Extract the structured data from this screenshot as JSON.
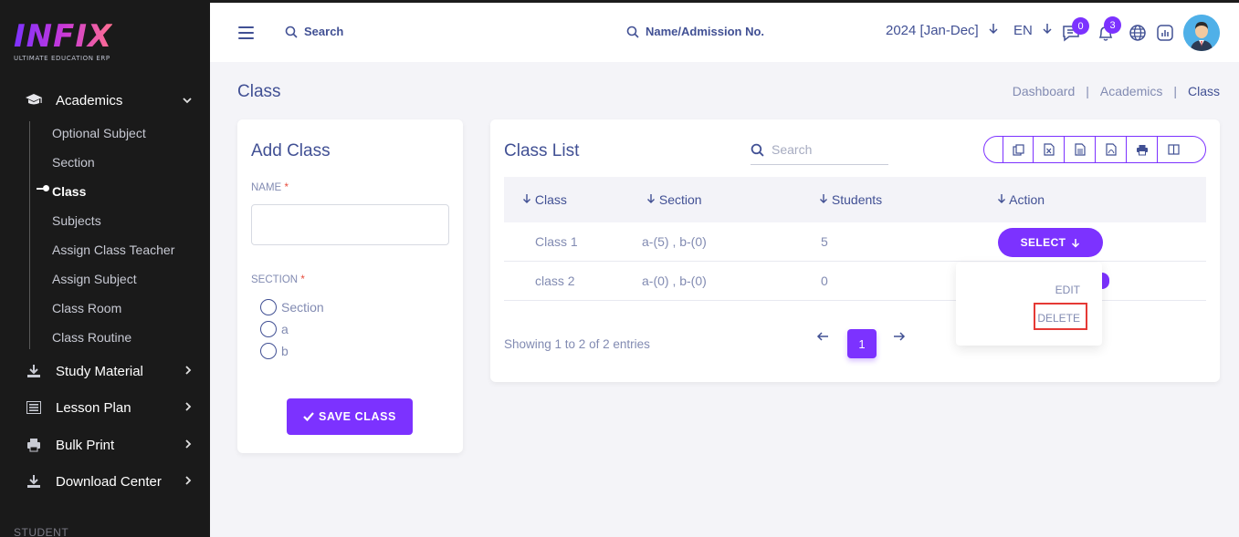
{
  "brand": {
    "name": "INFIX",
    "tagline": "ULTIMATE EDUCATION ERP"
  },
  "sidebar": {
    "academics": {
      "label": "Academics"
    },
    "academics_items": [
      {
        "label": "Optional Subject"
      },
      {
        "label": "Section"
      },
      {
        "label": "Class"
      },
      {
        "label": "Subjects"
      },
      {
        "label": "Assign Class Teacher"
      },
      {
        "label": "Assign Subject"
      },
      {
        "label": "Class Room"
      },
      {
        "label": "Class Routine"
      }
    ],
    "menu": [
      {
        "label": "Study Material"
      },
      {
        "label": "Lesson Plan"
      },
      {
        "label": "Bulk Print"
      },
      {
        "label": "Download Center"
      }
    ],
    "section_label": "STUDENT"
  },
  "header": {
    "search_label": "Search",
    "admission_search_label": "Name/Admission No.",
    "academic_year": "2024 [Jan-Dec]",
    "language": "EN",
    "messages_count": "0",
    "notifications_count": "3"
  },
  "page": {
    "title": "Class",
    "breadcrumb": [
      "Dashboard",
      "Academics",
      "Class"
    ]
  },
  "add_class": {
    "title": "Add Class",
    "name_label": "NAME",
    "section_label": "SECTION",
    "required_mark": "*",
    "sections": [
      "Section",
      "a",
      "b"
    ],
    "save_label": "SAVE CLASS"
  },
  "class_list": {
    "title": "Class List",
    "search_placeholder": "Search",
    "columns": [
      "Class",
      "Section",
      "Students",
      "Action"
    ],
    "rows": [
      {
        "class": "Class 1",
        "section": "a-(5) , b-(0)",
        "students": "5"
      },
      {
        "class": "class 2",
        "section": "a-(0) , b-(0)",
        "students": "0"
      }
    ],
    "select_label": "SELECT",
    "showing": "Showing 1 to 2 of 2 entries",
    "current_page": "1"
  },
  "action_menu": {
    "edit": "EDIT",
    "delete": "DELETE"
  },
  "colors": {
    "accent": "#7c32ff",
    "sidebar_bg": "#1a1a1a",
    "text_primary": "#415094",
    "text_muted": "#828bb2",
    "highlight": "#e53935"
  }
}
